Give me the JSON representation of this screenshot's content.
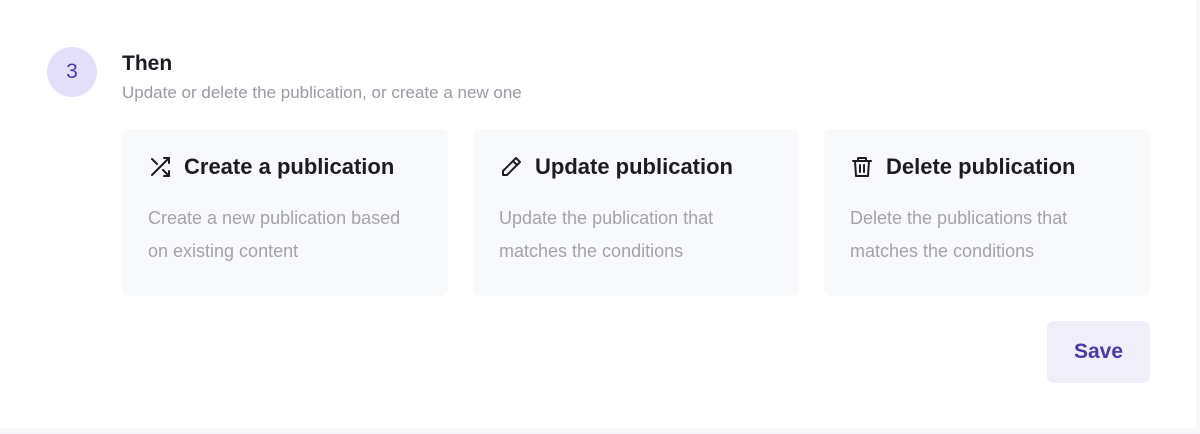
{
  "step": {
    "number": "3",
    "title": "Then",
    "subtitle": "Update or delete the publication, or create a new one"
  },
  "actions": [
    {
      "icon": "shuffle-icon",
      "title": "Create a publication",
      "description": "Create a new publication based on existing content"
    },
    {
      "icon": "pencil-icon",
      "title": "Update publication",
      "description": "Update the publication that matches the conditions"
    },
    {
      "icon": "trash-icon",
      "title": "Delete publication",
      "description": "Delete the publications that matches the conditions"
    }
  ],
  "save_label": "Save",
  "colors": {
    "accent": "#4a3aa8",
    "badge_bg": "#e4e0fa",
    "button_bg": "#efeef9",
    "card_bg": "#f8f9fb",
    "muted_text": "#a3a3ab"
  }
}
